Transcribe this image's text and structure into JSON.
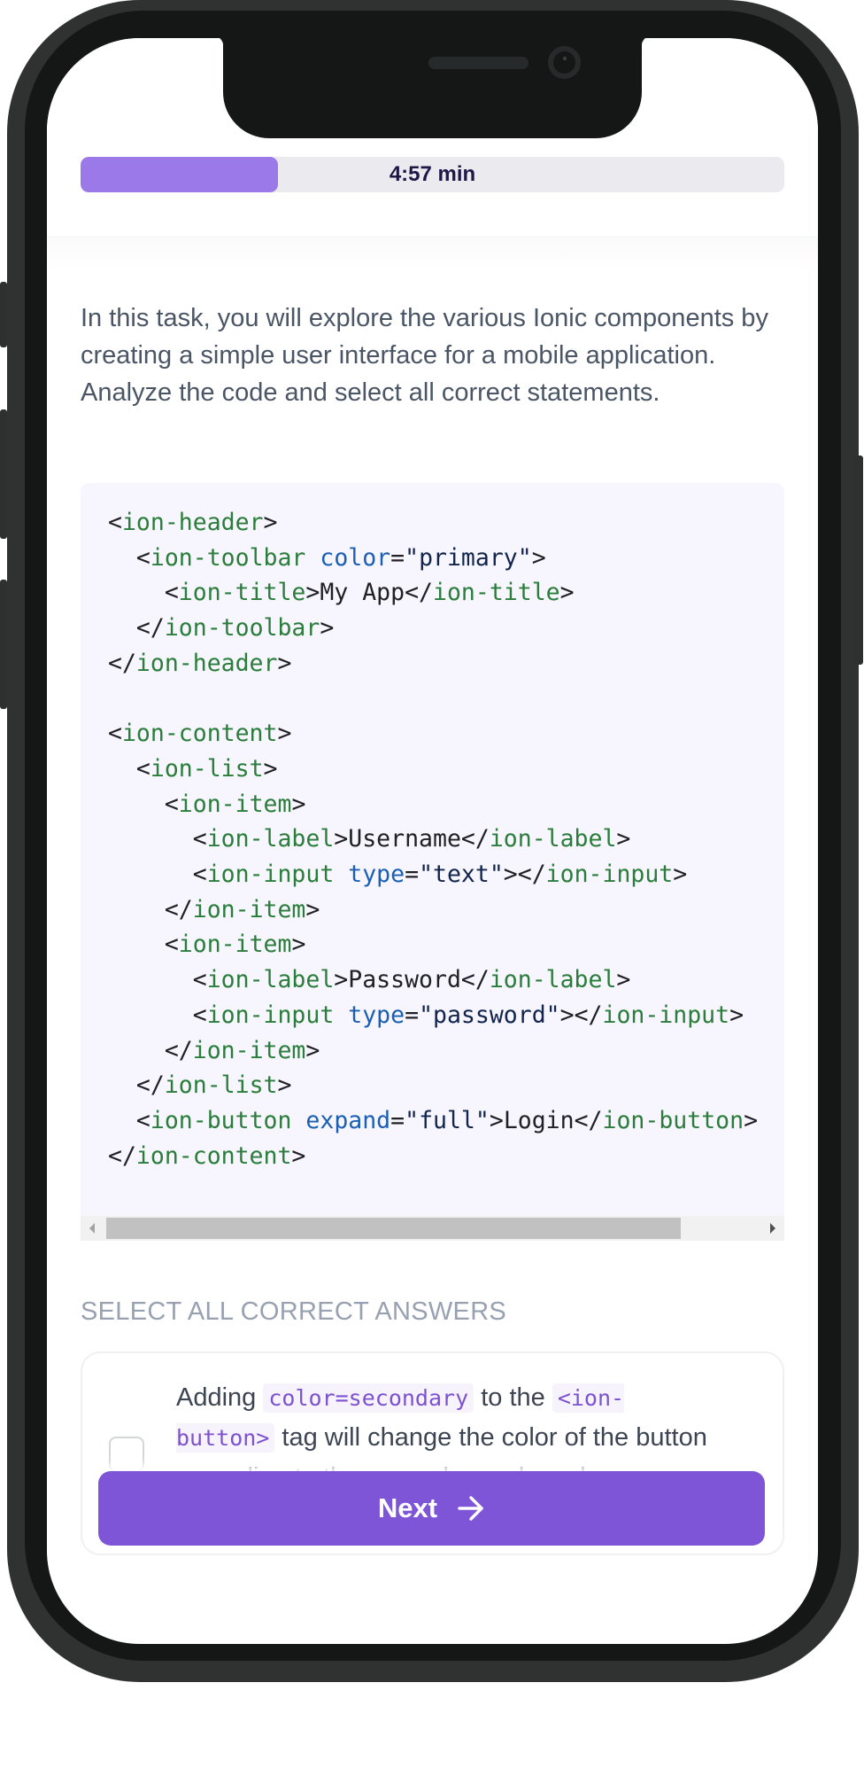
{
  "progress": {
    "label": "4:57 min",
    "fill_fraction": 0.28,
    "fill_color": "#9c79e8"
  },
  "task": {
    "intro": "In this task, you will explore the various Ionic components by creating a simple user interface for a mobile application. Analyze the code and select all correct statements."
  },
  "code": {
    "language": "html",
    "lines": [
      [
        {
          "t": "punct",
          "v": "<"
        },
        {
          "t": "tag",
          "v": "ion-header"
        },
        {
          "t": "punct",
          "v": ">"
        }
      ],
      [
        {
          "t": "text",
          "v": "  "
        },
        {
          "t": "punct",
          "v": "<"
        },
        {
          "t": "tag",
          "v": "ion-toolbar"
        },
        {
          "t": "text",
          "v": " "
        },
        {
          "t": "attr",
          "v": "color"
        },
        {
          "t": "punct",
          "v": "="
        },
        {
          "t": "str",
          "v": "\"primary\""
        },
        {
          "t": "punct",
          "v": ">"
        }
      ],
      [
        {
          "t": "text",
          "v": "    "
        },
        {
          "t": "punct",
          "v": "<"
        },
        {
          "t": "tag",
          "v": "ion-title"
        },
        {
          "t": "punct",
          "v": ">"
        },
        {
          "t": "text",
          "v": "My App"
        },
        {
          "t": "punct",
          "v": "</"
        },
        {
          "t": "tag",
          "v": "ion-title"
        },
        {
          "t": "punct",
          "v": ">"
        }
      ],
      [
        {
          "t": "text",
          "v": "  "
        },
        {
          "t": "punct",
          "v": "</"
        },
        {
          "t": "tag",
          "v": "ion-toolbar"
        },
        {
          "t": "punct",
          "v": ">"
        }
      ],
      [
        {
          "t": "punct",
          "v": "</"
        },
        {
          "t": "tag",
          "v": "ion-header"
        },
        {
          "t": "punct",
          "v": ">"
        }
      ],
      [],
      [
        {
          "t": "punct",
          "v": "<"
        },
        {
          "t": "tag",
          "v": "ion-content"
        },
        {
          "t": "punct",
          "v": ">"
        }
      ],
      [
        {
          "t": "text",
          "v": "  "
        },
        {
          "t": "punct",
          "v": "<"
        },
        {
          "t": "tag",
          "v": "ion-list"
        },
        {
          "t": "punct",
          "v": ">"
        }
      ],
      [
        {
          "t": "text",
          "v": "    "
        },
        {
          "t": "punct",
          "v": "<"
        },
        {
          "t": "tag",
          "v": "ion-item"
        },
        {
          "t": "punct",
          "v": ">"
        }
      ],
      [
        {
          "t": "text",
          "v": "      "
        },
        {
          "t": "punct",
          "v": "<"
        },
        {
          "t": "tag",
          "v": "ion-label"
        },
        {
          "t": "punct",
          "v": ">"
        },
        {
          "t": "text",
          "v": "Username"
        },
        {
          "t": "punct",
          "v": "</"
        },
        {
          "t": "tag",
          "v": "ion-label"
        },
        {
          "t": "punct",
          "v": ">"
        }
      ],
      [
        {
          "t": "text",
          "v": "      "
        },
        {
          "t": "punct",
          "v": "<"
        },
        {
          "t": "tag",
          "v": "ion-input"
        },
        {
          "t": "text",
          "v": " "
        },
        {
          "t": "attr",
          "v": "type"
        },
        {
          "t": "punct",
          "v": "="
        },
        {
          "t": "str",
          "v": "\"text\""
        },
        {
          "t": "punct",
          "v": "></"
        },
        {
          "t": "tag",
          "v": "ion-input"
        },
        {
          "t": "punct",
          "v": ">"
        }
      ],
      [
        {
          "t": "text",
          "v": "    "
        },
        {
          "t": "punct",
          "v": "</"
        },
        {
          "t": "tag",
          "v": "ion-item"
        },
        {
          "t": "punct",
          "v": ">"
        }
      ],
      [
        {
          "t": "text",
          "v": "    "
        },
        {
          "t": "punct",
          "v": "<"
        },
        {
          "t": "tag",
          "v": "ion-item"
        },
        {
          "t": "punct",
          "v": ">"
        }
      ],
      [
        {
          "t": "text",
          "v": "      "
        },
        {
          "t": "punct",
          "v": "<"
        },
        {
          "t": "tag",
          "v": "ion-label"
        },
        {
          "t": "punct",
          "v": ">"
        },
        {
          "t": "text",
          "v": "Password"
        },
        {
          "t": "punct",
          "v": "</"
        },
        {
          "t": "tag",
          "v": "ion-label"
        },
        {
          "t": "punct",
          "v": ">"
        }
      ],
      [
        {
          "t": "text",
          "v": "      "
        },
        {
          "t": "punct",
          "v": "<"
        },
        {
          "t": "tag",
          "v": "ion-input"
        },
        {
          "t": "text",
          "v": " "
        },
        {
          "t": "attr",
          "v": "type"
        },
        {
          "t": "punct",
          "v": "="
        },
        {
          "t": "str",
          "v": "\"password\""
        },
        {
          "t": "punct",
          "v": "></"
        },
        {
          "t": "tag",
          "v": "ion-input"
        },
        {
          "t": "punct",
          "v": ">"
        }
      ],
      [
        {
          "t": "text",
          "v": "    "
        },
        {
          "t": "punct",
          "v": "</"
        },
        {
          "t": "tag",
          "v": "ion-item"
        },
        {
          "t": "punct",
          "v": ">"
        }
      ],
      [
        {
          "t": "text",
          "v": "  "
        },
        {
          "t": "punct",
          "v": "</"
        },
        {
          "t": "tag",
          "v": "ion-list"
        },
        {
          "t": "punct",
          "v": ">"
        }
      ],
      [
        {
          "t": "text",
          "v": "  "
        },
        {
          "t": "punct",
          "v": "<"
        },
        {
          "t": "tag",
          "v": "ion-button"
        },
        {
          "t": "text",
          "v": " "
        },
        {
          "t": "attr",
          "v": "expand"
        },
        {
          "t": "punct",
          "v": "="
        },
        {
          "t": "str",
          "v": "\"full\""
        },
        {
          "t": "punct",
          "v": ">"
        },
        {
          "t": "text",
          "v": "Login"
        },
        {
          "t": "punct",
          "v": "</"
        },
        {
          "t": "tag",
          "v": "ion-button"
        },
        {
          "t": "punct",
          "v": ">"
        }
      ],
      [
        {
          "t": "punct",
          "v": "</"
        },
        {
          "t": "tag",
          "v": "ion-content"
        },
        {
          "t": "punct",
          "v": ">"
        }
      ]
    ],
    "scroll_position_fraction": 0.0,
    "scroll_visible_fraction": 0.88
  },
  "answers": {
    "heading": "Select all correct answers",
    "options": [
      {
        "checked": false,
        "parts": [
          {
            "type": "text",
            "v": "Adding "
          },
          {
            "type": "code",
            "v": "color=secondary"
          },
          {
            "type": "text",
            "v": " to the "
          },
          {
            "type": "code",
            "v": "<ion-button>"
          },
          {
            "type": "text",
            "v": " tag will change the color of the button according to the secondary color scheme."
          }
        ]
      }
    ]
  },
  "footer": {
    "next_label": "Next",
    "next_icon": "arrow-right-icon",
    "button_color": "#7d55d6"
  }
}
